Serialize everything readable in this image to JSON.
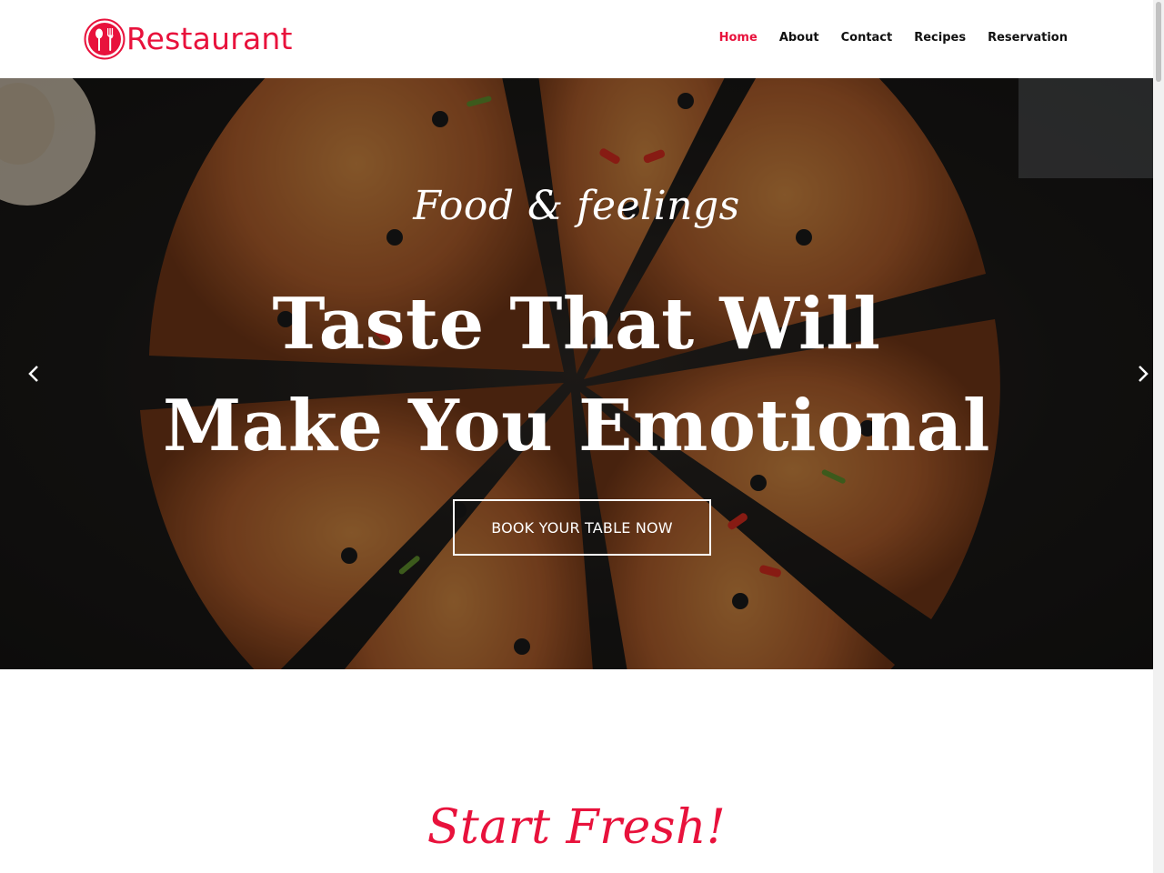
{
  "brand": {
    "name": "Restaurant",
    "logo_icon": "spoon-fork-icon",
    "color": "#e8123c"
  },
  "nav": {
    "items": [
      {
        "label": "Home",
        "active": true
      },
      {
        "label": "About",
        "active": false
      },
      {
        "label": "Contact",
        "active": false
      },
      {
        "label": "Recipes",
        "active": false
      },
      {
        "label": "Reservation",
        "active": false
      }
    ]
  },
  "hero": {
    "kicker": "Food & feelings",
    "title_line1": "Taste That Will",
    "title_line2": "Make You Emotional",
    "cta_label": "BOOK YOUR TABLE NOW",
    "prev_icon": "chevron-left-icon",
    "next_icon": "chevron-right-icon"
  },
  "section": {
    "heading": "Start Fresh!"
  },
  "colors": {
    "accent": "#e8123c",
    "text_dark": "#111111",
    "white": "#ffffff"
  }
}
